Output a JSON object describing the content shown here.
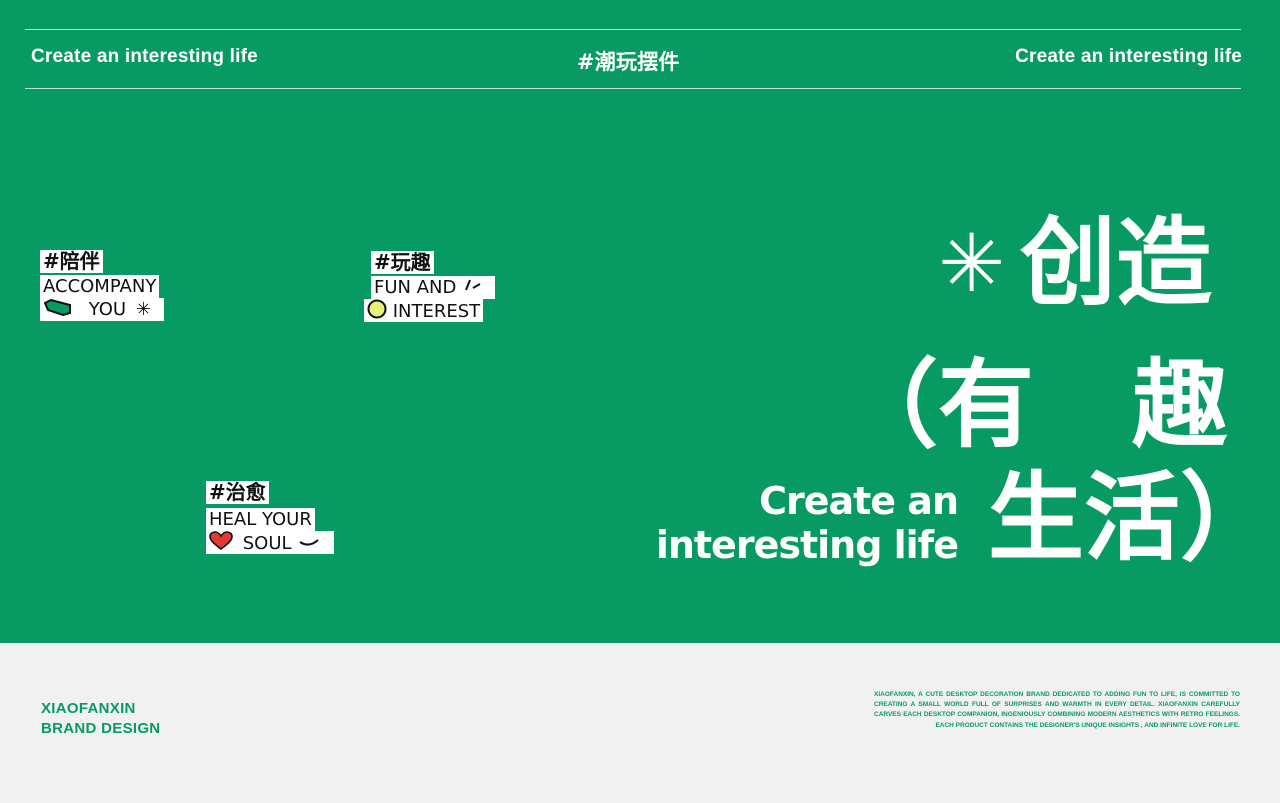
{
  "header": {
    "left_text": "Create an interesting life",
    "center_tag": "#潮玩摆件",
    "right_text": "Create an interesting life"
  },
  "stickers": [
    {
      "tag": "#陪伴",
      "line1": "ACCOMPANY",
      "line2": "YOU",
      "icon": "green-hexagon-icon",
      "accent": "#079b63"
    },
    {
      "tag": "#玩趣",
      "line1": "FUN AND",
      "line2": "INTEREST",
      "icon": "yellow-circle-icon",
      "accent": "#e9f07a"
    },
    {
      "tag": "#治愈",
      "line1": "HEAL YOUR",
      "line2": "SOUL",
      "icon": "red-heart-icon",
      "accent": "#e53935"
    }
  ],
  "hero": {
    "line1": "创造",
    "line2a": "（有",
    "line2b": "趣",
    "line3": "生活）",
    "en_line1": "Create an",
    "en_line2": "interesting life"
  },
  "footer": {
    "brand_line1": "XIAOFANXIN",
    "brand_line2": "BRAND DESIGN",
    "description": "XIAOFANXIN, A CUTE DESKTOP DECORATION BRAND DEDICATED TO ADDING FUN TO LIFE, IS COMMITTED TO CREATING A SMALL WORLD FULL OF SURPRISES AND WARMTH IN EVERY DETAIL. XIAOFANXIN CAREFULLY CARVES EACH DESKTOP COMPANION, INGENIOUSLY COMBINING MODERN AESTHETICS WITH RETRO FEELINGS. EACH PRODUCT CONTAINS THE DESIGNER'S UNIQUE INSIGHTS , AND INFINITE LOVE FOR LIFE."
  },
  "colors": {
    "brand_green": "#079b63",
    "footer_bg": "#f1f1f1",
    "text_on_green": "#ffffff"
  }
}
